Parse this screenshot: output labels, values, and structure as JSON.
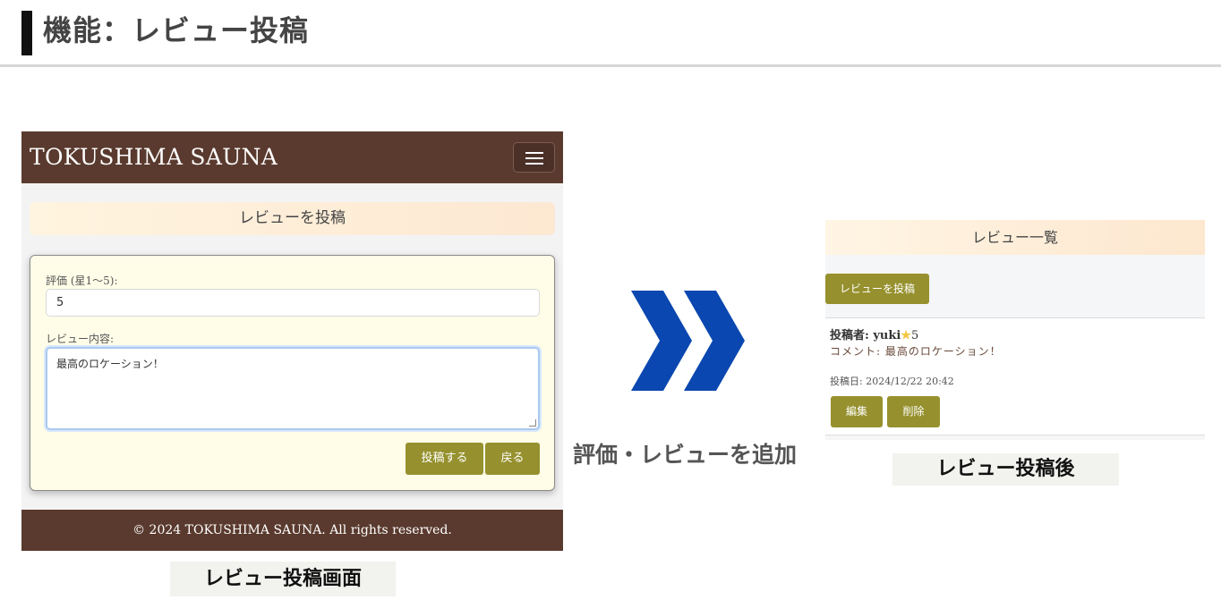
{
  "slide": {
    "title": "機能：レビュー投稿"
  },
  "left_screen": {
    "brand": "TOKUSHIMA SAUNA",
    "form_heading": "レビューを投稿",
    "rating_label": "評価 (星1〜5):",
    "rating_value": "5",
    "review_label": "レビュー内容:",
    "review_value": "最高のロケーション！",
    "submit_label": "投稿する",
    "back_label": "戻る",
    "footer": "© 2024 TOKUSHIMA SAUNA. All rights reserved.",
    "caption": "レビュー投稿画面"
  },
  "arrow": {
    "label": "評価・レビューを追加",
    "color": "#0a47b0"
  },
  "right_screen": {
    "list_heading": "レビュー一覧",
    "post_button_label": "レビューを投稿",
    "review": {
      "author": "投稿者: yuki",
      "rating": "5",
      "comment": "コメント: 最高のロケーション！",
      "date": "投稿日: 2024/12/22 20:42",
      "edit_label": "編集",
      "delete_label": "削除"
    },
    "caption": "レビュー投稿後"
  },
  "colors": {
    "navbar": "#5a3a2e",
    "button": "#96912e",
    "star": "#f5c542"
  }
}
